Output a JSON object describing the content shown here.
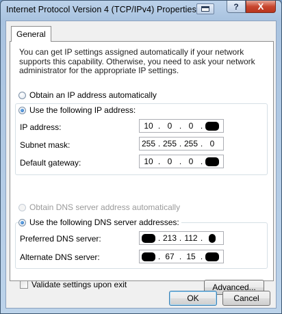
{
  "window": {
    "title": "Internet Protocol Version 4 (TCP/IPv4) Properties",
    "help_glyph": "?",
    "close_glyph": "X"
  },
  "tabs": [
    {
      "label": "General",
      "selected": true
    }
  ],
  "description": "You can get IP settings assigned automatically if your network supports this capability. Otherwise, you need to ask your network administrator for the appropriate IP settings.",
  "ip_mode": {
    "auto_label": "Obtain an IP address automatically",
    "manual_label": "Use the following IP address:",
    "selected": "manual"
  },
  "ip_fields": {
    "ip_address": {
      "label": "IP address:",
      "octets": [
        "10",
        "0",
        "0",
        ""
      ]
    },
    "subnet_mask": {
      "label": "Subnet mask:",
      "octets": [
        "255",
        "255",
        "255",
        "0"
      ]
    },
    "default_gateway": {
      "label": "Default gateway:",
      "octets": [
        "10",
        "0",
        "0",
        ""
      ]
    }
  },
  "dns_mode": {
    "auto_label": "Obtain DNS server address automatically",
    "manual_label": "Use the following DNS server addresses:",
    "selected": "manual"
  },
  "dns_fields": {
    "preferred": {
      "label": "Preferred DNS server:",
      "octets": [
        "",
        "213",
        "112",
        ""
      ]
    },
    "alternate": {
      "label": "Alternate DNS server:",
      "octets": [
        "",
        "67",
        "15",
        ""
      ]
    }
  },
  "validate": {
    "label": "Validate settings upon exit",
    "checked": false
  },
  "buttons": {
    "advanced": "Advanced...",
    "ok": "OK",
    "cancel": "Cancel"
  },
  "colors": {
    "frame": "#a9c3e0",
    "close_button": "#c8472f",
    "panel": "#ffffff",
    "dialog": "#f0f0f0"
  }
}
